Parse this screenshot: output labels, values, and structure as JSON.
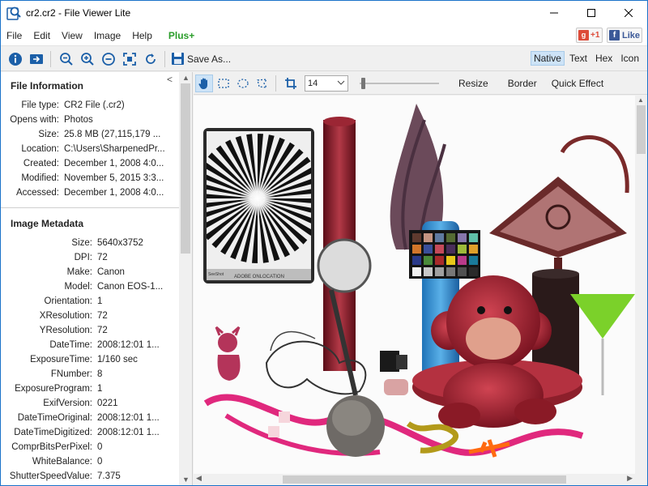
{
  "window": {
    "title": "cr2.cr2 - File Viewer Lite"
  },
  "menu": {
    "items": [
      "File",
      "Edit",
      "View",
      "Image",
      "Help"
    ],
    "plus": "Plus+"
  },
  "social": {
    "gplus": "+1",
    "fb": "Like"
  },
  "toolbar": {
    "save_as": "Save As...",
    "view_modes": [
      "Native",
      "Text",
      "Hex",
      "Icon"
    ],
    "active_mode": "Native"
  },
  "file_info": {
    "title": "File Information",
    "rows": [
      {
        "k": "File type:",
        "v": "CR2 File (.cr2)"
      },
      {
        "k": "Opens with:",
        "v": "Photos"
      },
      {
        "k": "Size:",
        "v": "25.8 MB (27,115,179 ..."
      },
      {
        "k": "Location:",
        "v": "C:\\Users\\SharpenedPr..."
      },
      {
        "k": "Created:",
        "v": "December 1, 2008 4:0..."
      },
      {
        "k": "Modified:",
        "v": "November 5, 2015 3:3..."
      },
      {
        "k": "Accessed:",
        "v": "December 1, 2008 4:0..."
      }
    ]
  },
  "metadata": {
    "title": "Image Metadata",
    "rows": [
      {
        "k": "Size:",
        "v": "5640x3752"
      },
      {
        "k": "DPI:",
        "v": "72"
      },
      {
        "k": "Make:",
        "v": "Canon"
      },
      {
        "k": "Model:",
        "v": "Canon EOS-1..."
      },
      {
        "k": "Orientation:",
        "v": "1"
      },
      {
        "k": "XResolution:",
        "v": "72"
      },
      {
        "k": "YResolution:",
        "v": "72"
      },
      {
        "k": "DateTime:",
        "v": "2008:12:01 1..."
      },
      {
        "k": "ExposureTime:",
        "v": "1/160 sec"
      },
      {
        "k": "FNumber:",
        "v": "8"
      },
      {
        "k": "ExposureProgram:",
        "v": "1"
      },
      {
        "k": "ExifVersion:",
        "v": "0221"
      },
      {
        "k": "DateTimeOriginal:",
        "v": "2008:12:01 1..."
      },
      {
        "k": "DateTimeDigitized:",
        "v": "2008:12:01 1..."
      },
      {
        "k": "ComprBitsPerPixel:",
        "v": "0"
      },
      {
        "k": "WhiteBalance:",
        "v": "0"
      },
      {
        "k": "ShutterSpeedValue:",
        "v": "7.375"
      }
    ]
  },
  "image_tools": {
    "zoom": "14",
    "resize": "Resize",
    "border": "Border",
    "quick_effect": "Quick Effect"
  },
  "photo": {
    "chart_label": "ADOBE ONLOCATION",
    "chart_brand": "SeeShot"
  }
}
